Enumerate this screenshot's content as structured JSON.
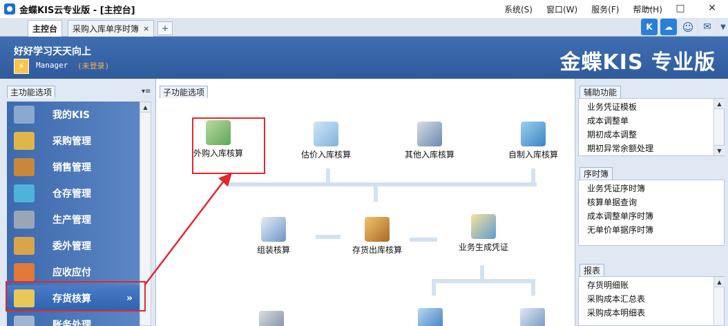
{
  "window": {
    "title": "金蝶KIS云专业版 - [主控台]",
    "menus": [
      "系统(S)",
      "窗口(W)",
      "服务(F)",
      "帮助(H)"
    ],
    "controls": {
      "minimize": "—",
      "maximize": "□",
      "close": "✕"
    }
  },
  "tabs": [
    {
      "label": "主控台",
      "active": true
    },
    {
      "label": "采购入库单序时簿",
      "active": false,
      "close": "×"
    }
  ],
  "tab_add": "+",
  "header": {
    "company": "好好学习天天向上",
    "user": "Manager",
    "status": "(未登录)",
    "brand": "金蝶KIS 专业版"
  },
  "left_panel": {
    "title": "主功能选项",
    "items": [
      {
        "label": "我的KIS",
        "icon": "my-kis-icon",
        "active": false
      },
      {
        "label": "采购管理",
        "icon": "purchase-icon",
        "active": false
      },
      {
        "label": "销售管理",
        "icon": "sales-icon",
        "active": false
      },
      {
        "label": "仓存管理",
        "icon": "warehouse-icon",
        "active": false
      },
      {
        "label": "生产管理",
        "icon": "production-icon",
        "active": false
      },
      {
        "label": "委外管理",
        "icon": "outsourcing-icon",
        "active": false
      },
      {
        "label": "应收应付",
        "icon": "receivable-icon",
        "active": false
      },
      {
        "label": "存货核算",
        "icon": "inventory-accounting-icon",
        "active": true,
        "arrows": "»"
      },
      {
        "label": "账务处理",
        "icon": "accounting-icon",
        "active": false
      }
    ]
  },
  "center": {
    "title": "子功能选项",
    "functions": [
      {
        "label": "外购入库核算",
        "icon": "purchase-in-icon"
      },
      {
        "label": "估价入库核算",
        "icon": "estimate-in-icon"
      },
      {
        "label": "其他入库核算",
        "icon": "other-in-icon"
      },
      {
        "label": "自制入库核算",
        "icon": "self-made-in-icon"
      },
      {
        "label": "组装核算",
        "icon": "assembly-icon"
      },
      {
        "label": "存货出库核算",
        "icon": "stock-out-icon"
      },
      {
        "label": "业务生成凭证",
        "icon": "voucher-icon"
      }
    ]
  },
  "right_panel": {
    "aux": {
      "title": "辅助功能",
      "items": [
        "业务凭证模板",
        "成本调整单",
        "期初成本调整",
        "期初异常余额处理"
      ]
    },
    "journal": {
      "title": "序时簿",
      "items": [
        "业务凭证序时簿",
        "核算单据查询",
        "成本调整单序时簿",
        "无单价单据序时簿"
      ]
    },
    "reports": {
      "title": "报表",
      "items": [
        "存货明细账",
        "采购成本汇总表",
        "采购成本明细表"
      ]
    }
  },
  "colors": {
    "highlight": "#e0282e",
    "nav_bg": "#3d6aae",
    "header_bg": "#3f6eb1"
  }
}
